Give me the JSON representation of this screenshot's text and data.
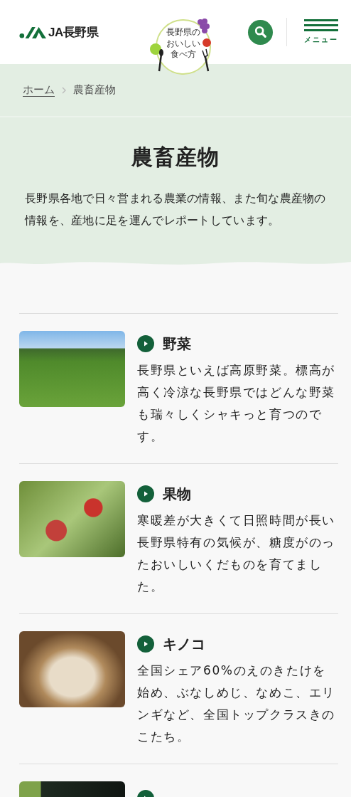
{
  "header": {
    "logo": "JA長野県",
    "center_logo": [
      "長野県の",
      "おいしい",
      "食べ方"
    ],
    "menu_label": "メニュー"
  },
  "breadcrumb": [
    {
      "label": "ホーム",
      "kind": "link"
    },
    {
      "label": "農畜産物",
      "kind": "current"
    }
  ],
  "hero": {
    "title": "農畜産物",
    "description": "長野県各地で日々営まれる農業の情報、また旬な農産物の情報を、産地に足を運んでレポートしています。"
  },
  "items": [
    {
      "kind": "full",
      "title": "野菜",
      "text": "長野県といえば高原野菜。標高が高く冷涼な長野県ではどんな野菜も瑞々しくシャキっと育つのです。"
    },
    {
      "kind": "full",
      "title": "果物",
      "text": "寒暖差が大きくて日照時間が長い長野県特有の気候が、糖度がのったおいしいくだものを育てました。"
    },
    {
      "kind": "full",
      "title": "キノコ",
      "text": "全国シェア60%のえのきたけを始め、ぶなしめじ、なめこ、エリンギなど、全国トップクラスきのこたち。"
    },
    {
      "kind": "cut"
    }
  ]
}
